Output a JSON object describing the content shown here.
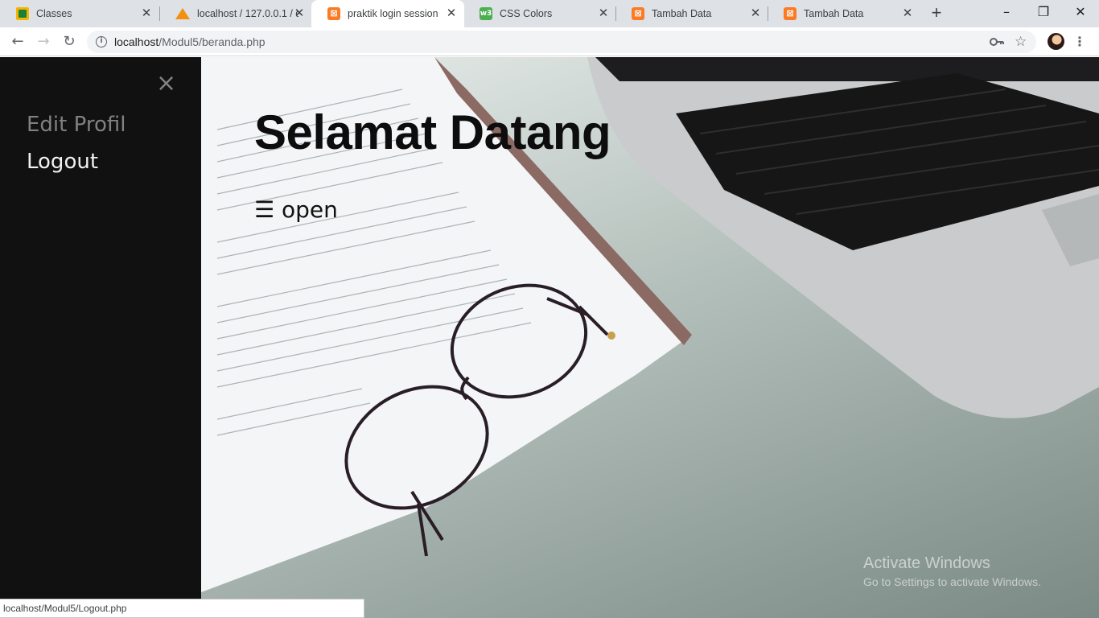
{
  "browser": {
    "tabs": [
      {
        "title": "Classes",
        "icon": "google-classroom-icon"
      },
      {
        "title": "localhost / 127.0.0.1 / d",
        "icon": "phpmyadmin-icon"
      },
      {
        "title": "praktik login session",
        "icon": "xampp-icon",
        "active": true
      },
      {
        "title": "CSS Colors",
        "icon": "w3schools-icon"
      },
      {
        "title": "Tambah Data",
        "icon": "xampp-icon"
      },
      {
        "title": "Tambah Data",
        "icon": "xampp-icon"
      }
    ],
    "address": {
      "host": "localhost",
      "path": "/Modul5/beranda.php"
    }
  },
  "sidenav": {
    "close_symbol": "×",
    "links": [
      {
        "label": "Edit Profil"
      },
      {
        "label": "Logout"
      }
    ]
  },
  "main": {
    "heading": "Selamat Datang",
    "open_button": "☰ open"
  },
  "watermark": {
    "title": "Activate Windows",
    "subtitle": "Go to Settings to activate Windows."
  },
  "status_bar": {
    "url": "localhost/Modul5/Logout.php"
  },
  "colors": {
    "sidenav_bg": "#111111",
    "link_active": "#f1f1f1",
    "link_muted": "#818181",
    "tabstrip_bg": "#dee1e6"
  }
}
